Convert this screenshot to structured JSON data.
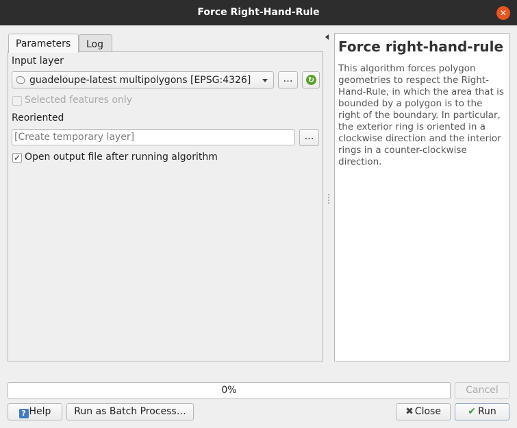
{
  "window": {
    "title": "Force Right-Hand-Rule",
    "close_icon": "close-icon",
    "accent_color": "#e9541f"
  },
  "tabs": [
    {
      "label": "Parameters",
      "active": true
    },
    {
      "label": "Log",
      "active": false
    }
  ],
  "parameters": {
    "input_layer_label": "Input layer",
    "input_layer_value": "guadeloupe-latest multipolygons [EPSG:4326]",
    "browse_label": "…",
    "selected_only_label": "Selected features only",
    "selected_only_checked": false,
    "reoriented_label": "Reoriented",
    "reoriented_placeholder": "[Create temporary layer]",
    "output_browse_label": "…",
    "open_output_label": "Open output file after running algorithm",
    "open_output_checked": true,
    "open_output_mark": "✓"
  },
  "help": {
    "title": "Force right-hand-rule",
    "text": "This algorithm forces polygon geometries to respect the Right-Hand-Rule, in which the area that is bounded by a polygon is to the right of the boundary. In particular, the exterior ring is oriented in a clockwise direction and the interior rings in a counter-clockwise direction."
  },
  "footer": {
    "progress_text": "0%",
    "progress_value": 0,
    "cancel_label": "Cancel",
    "help_label": "Help",
    "batch_label": "Run as Batch Process…",
    "close_label": "Close",
    "run_label": "Run"
  }
}
